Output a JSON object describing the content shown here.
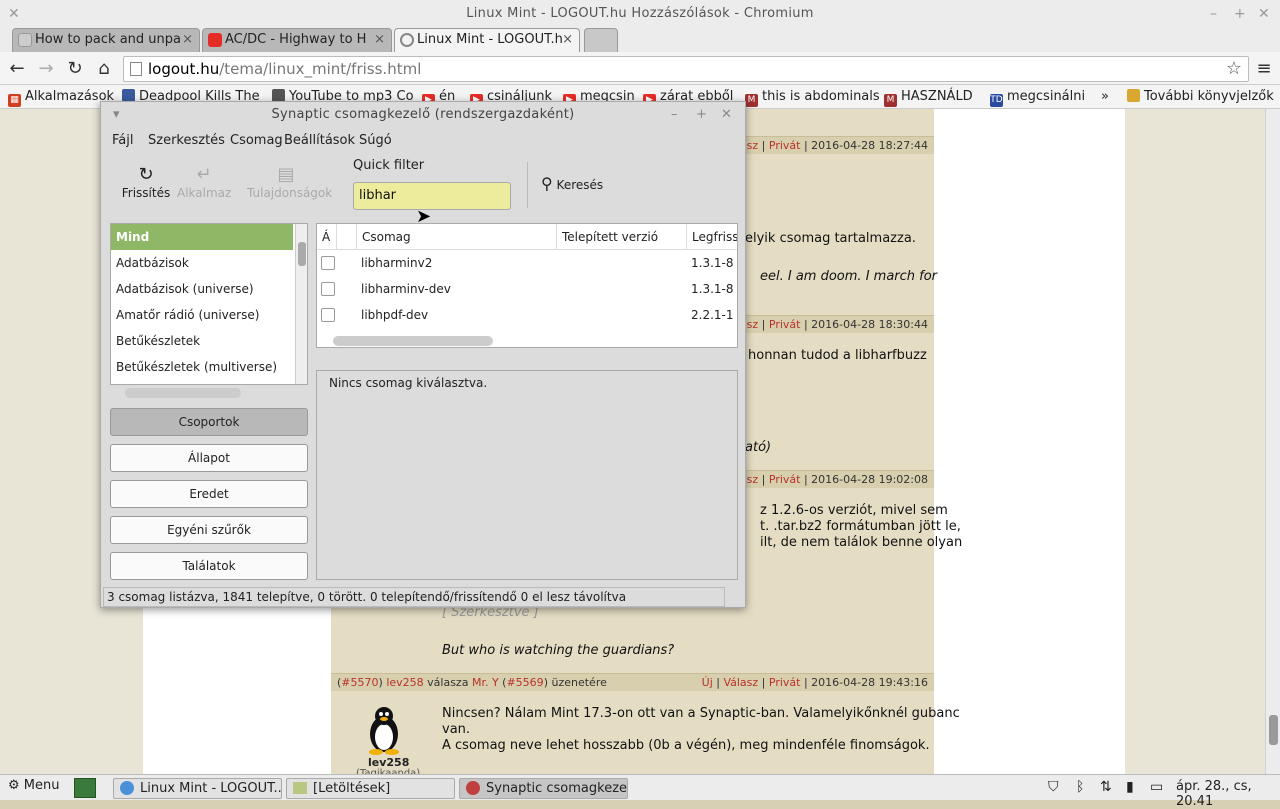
{
  "window": {
    "title": "Linux Mint - LOGOUT.hu Hozzászólások - Chromium"
  },
  "tabs": [
    {
      "label": "How to pack and unpa",
      "close": "×"
    },
    {
      "label": "AC/DC - Highway to H",
      "close": "×"
    },
    {
      "label": "Linux Mint - LOGOUT.h",
      "close": "×"
    }
  ],
  "nav": {
    "back": "back-icon",
    "forward": "forward-icon",
    "reload": "reload-icon",
    "home": "home-icon"
  },
  "omnibox": {
    "domain": "logout.hu",
    "path": "/tema/linux_mint/friss.html"
  },
  "bookmarks": [
    {
      "label": "Alkalmazások",
      "icon": "apps-icon"
    },
    {
      "label": "Deadpool Kills The",
      "icon": "page-icon"
    },
    {
      "label": "YouTube to mp3 Co",
      "icon": "page-icon"
    },
    {
      "label": "én",
      "icon": "youtube-icon"
    },
    {
      "label": "csináljunk",
      "icon": "youtube-icon"
    },
    {
      "label": "megcsin",
      "icon": "youtube-icon"
    },
    {
      "label": "zárat ebből",
      "icon": "youtube-icon"
    },
    {
      "label": "this is abdominals",
      "icon": "m-icon"
    },
    {
      "label": "HASZNÁLD",
      "icon": "m-icon"
    },
    {
      "label": "megcsinálni",
      "icon": "td-icon"
    }
  ],
  "bookmarks_more": "»",
  "bookmarks_other": "További könyvjelzők",
  "posts": [
    {
      "header_right_reply": "Válasz",
      "header_right_private": "Privát",
      "time": "2016-04-28 18:27:44",
      "lines": [
        "elyik csomag tartalmazza.",
        "eel. I am doom. I march for"
      ]
    },
    {
      "header_right_reply": "Válasz",
      "header_right_private": "Privát",
      "time": "2016-04-28 18:30:44",
      "lines": [
        "honnan tudod a libharfbuzz",
        "ató)"
      ]
    },
    {
      "header_right_reply": "Válasz",
      "header_right_private": "Privát",
      "time": "2016-04-28 19:02:08",
      "lines": [
        "z 1.2.6-os verziót, mivel sem",
        "t. .tar.bz2 formátumban jött le,",
        "ilt, de nem találok benne olyan",
        "[ Szerkesztve ]",
        "But who is watching the guardians?"
      ]
    },
    {
      "num": "#5570",
      "author": "lev258",
      "mid": "válasza",
      "to": "Mr. Y",
      "ref": "#5569",
      "suffix": "üzenetére",
      "new": "Új",
      "header_right_reply": "Válasz",
      "header_right_private": "Privát",
      "time": "2016-04-28 19:43:16",
      "lines": [
        "Nincsen? Nálam Mint 17.3-on ott van a Synaptic-ban. Valamelyikőnknél gubanc",
        "van.",
        "A csomag neve lehet hosszabb (0b a végén), meg mindenféle finomságok."
      ],
      "avatar_name": "lev258",
      "avatar_rank": "(Tagikaanda)"
    }
  ],
  "synaptic": {
    "title": "Synaptic csomagkezelő  (rendszergazdaként)",
    "menu": [
      "Fájl",
      "Szerkesztés",
      "Csomag",
      "Beállítások",
      "Súgó"
    ],
    "toolbar": [
      {
        "label": "Frissítés",
        "icon": "reload-icon"
      },
      {
        "label": "Alkalmaz",
        "icon": "apply-icon"
      },
      {
        "label": "Tulajdonságok",
        "icon": "properties-icon"
      }
    ],
    "quick_filter_label": "Quick filter",
    "quick_filter_value": "libhar",
    "search_label": "Keresés",
    "categories": [
      "Mind",
      "Adatbázisok",
      "Adatbázisok (universe)",
      "Amatőr rádió (universe)",
      "Betűkészletek",
      "Betűkészletek (multiverse)"
    ],
    "filter_buttons": [
      "Csoportok",
      "Állapot",
      "Eredet",
      "Egyéni szűrők",
      "Találatok"
    ],
    "columns": [
      "Á",
      "",
      "Csomag",
      "Telepített verzió",
      "Legfriss"
    ],
    "packages": [
      {
        "name": "libharminv2",
        "installed": "",
        "latest": "1.3.1-8"
      },
      {
        "name": "libharminv-dev",
        "installed": "",
        "latest": "1.3.1-8"
      },
      {
        "name": "libhpdf-dev",
        "installed": "",
        "latest": "2.2.1-1"
      }
    ],
    "description": "Nincs csomag kiválasztva.",
    "status": "3 csomag listázva, 1841 telepítve, 0 törött. 0 telepítendő/frissítendő 0 el lesz távolítva"
  },
  "taskbar": {
    "menu": "Menu",
    "items": [
      "Linux Mint - LOGOUT...",
      "[Letöltések]",
      "Synaptic csomagkezelő..."
    ],
    "clock": "ápr. 28., cs, 20.41"
  }
}
